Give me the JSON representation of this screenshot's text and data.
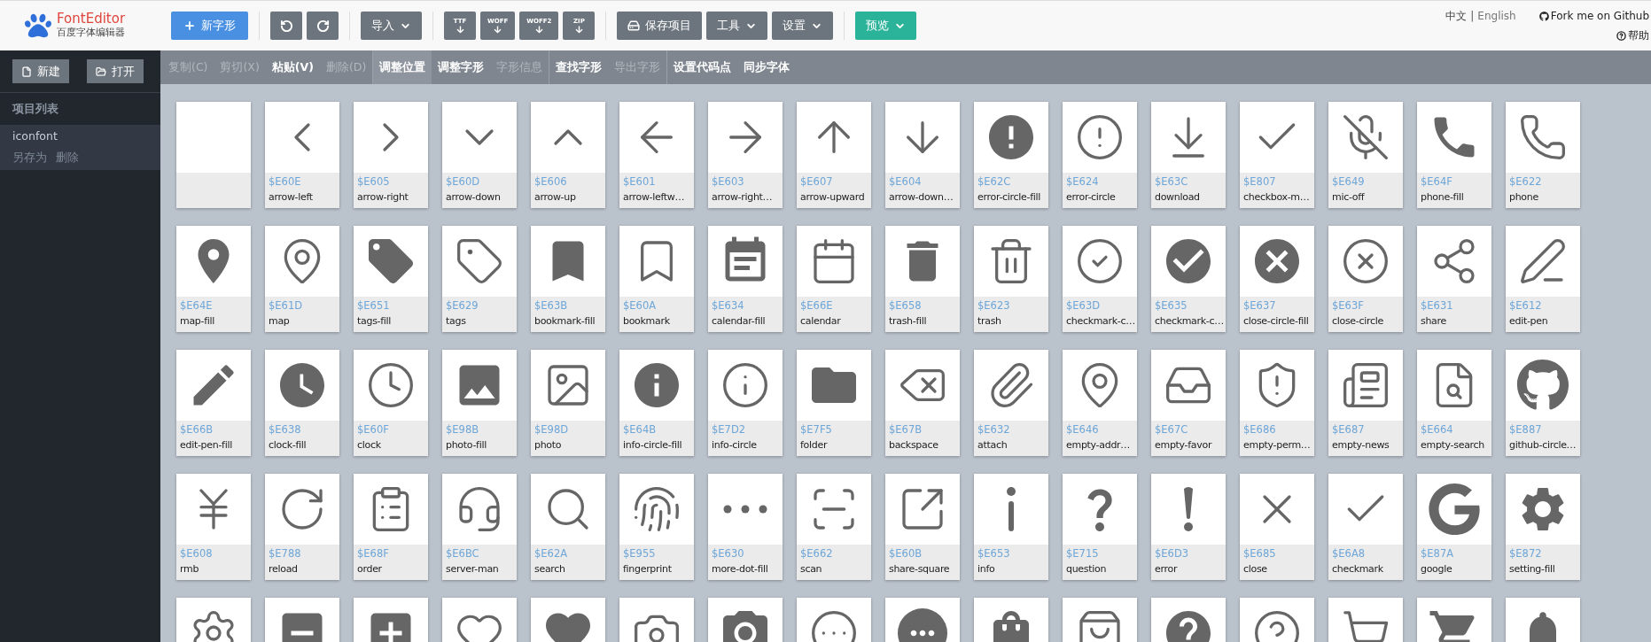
{
  "header": {
    "logo_title": "FontEditor",
    "logo_subtitle": "百度字体编辑器",
    "buttons": [
      {
        "kind": "primary",
        "label": "新字形"
      },
      {
        "kind": "undo"
      },
      {
        "kind": "redo"
      },
      {
        "kind": "dropdown",
        "label": "导入"
      },
      {
        "kind": "format",
        "label": "TTF"
      },
      {
        "kind": "format",
        "label": "WOFF"
      },
      {
        "kind": "format",
        "label": "WOFF2"
      },
      {
        "kind": "format",
        "label": "ZIP"
      },
      {
        "kind": "save",
        "label": "保存项目"
      },
      {
        "kind": "dropdown",
        "label": "工具"
      },
      {
        "kind": "dropdown",
        "label": "设置"
      },
      {
        "kind": "preview",
        "label": "预览"
      }
    ],
    "languages": [
      {
        "label": "中文",
        "selected": true
      },
      {
        "label": "English",
        "selected": false
      }
    ],
    "language_separator": "|",
    "github_link": "Fork me on Github",
    "help_link": "帮助"
  },
  "sidebar": {
    "buttons": [
      {
        "label": "新建"
      },
      {
        "label": "打开"
      }
    ],
    "heading": "项目列表",
    "projects": [
      {
        "name": "iconfont",
        "selected": true,
        "actions": [
          "另存为",
          "删除"
        ]
      }
    ]
  },
  "toolbar": {
    "groups": [
      [
        {
          "label": "复制(C)",
          "disabled": true,
          "selected": false
        },
        {
          "label": "剪切(X)",
          "disabled": true,
          "selected": false
        },
        {
          "label": "粘贴(V)",
          "disabled": false,
          "selected": false
        },
        {
          "label": "删除(D)",
          "disabled": true,
          "selected": false
        }
      ],
      [
        {
          "label": "调整位置",
          "disabled": false,
          "selected": true
        },
        {
          "label": "调整字形",
          "disabled": false,
          "selected": false
        },
        {
          "label": "字形信息",
          "disabled": true,
          "selected": false
        }
      ],
      [
        {
          "label": "查找字形",
          "disabled": false,
          "selected": false
        },
        {
          "label": "导出字形",
          "disabled": true,
          "selected": false
        }
      ],
      [
        {
          "label": "设置代码点",
          "disabled": false,
          "selected": false
        },
        {
          "label": "同步字体",
          "disabled": false,
          "selected": false
        }
      ]
    ]
  },
  "glyphs": [
    {
      "kind": "blank"
    },
    {
      "kind": "glyph",
      "code": "$E60E",
      "name": "arrow-left"
    },
    {
      "kind": "glyph",
      "code": "$E605",
      "name": "arrow-right"
    },
    {
      "kind": "glyph",
      "code": "$E60D",
      "name": "arrow-down"
    },
    {
      "kind": "glyph",
      "code": "$E606",
      "name": "arrow-up"
    },
    {
      "kind": "glyph",
      "code": "$E601",
      "name": "arrow-leftw…"
    },
    {
      "kind": "glyph",
      "code": "$E603",
      "name": "arrow-right…"
    },
    {
      "kind": "glyph",
      "code": "$E607",
      "name": "arrow-upward"
    },
    {
      "kind": "glyph",
      "code": "$E604",
      "name": "arrow-down…"
    },
    {
      "kind": "glyph",
      "code": "$E62C",
      "name": "error-circle-fill"
    },
    {
      "kind": "glyph",
      "code": "$E624",
      "name": "error-circle"
    },
    {
      "kind": "glyph",
      "code": "$E63C",
      "name": "download"
    },
    {
      "kind": "glyph",
      "code": "$E807",
      "name": "checkbox-m…"
    },
    {
      "kind": "glyph",
      "code": "$E649",
      "name": "mic-off"
    },
    {
      "kind": "glyph",
      "code": "$E64F",
      "name": "phone-fill"
    },
    {
      "kind": "glyph",
      "code": "$E622",
      "name": "phone"
    },
    {
      "kind": "glyph",
      "code": "$E64E",
      "name": "map-fill"
    },
    {
      "kind": "glyph",
      "code": "$E61D",
      "name": "map"
    },
    {
      "kind": "glyph",
      "code": "$E651",
      "name": "tags-fill"
    },
    {
      "kind": "glyph",
      "code": "$E629",
      "name": "tags"
    },
    {
      "kind": "glyph",
      "code": "$E63B",
      "name": "bookmark-fill"
    },
    {
      "kind": "glyph",
      "code": "$E60A",
      "name": "bookmark"
    },
    {
      "kind": "glyph",
      "code": "$E634",
      "name": "calendar-fill"
    },
    {
      "kind": "glyph",
      "code": "$E66E",
      "name": "calendar"
    },
    {
      "kind": "glyph",
      "code": "$E658",
      "name": "trash-fill"
    },
    {
      "kind": "glyph",
      "code": "$E623",
      "name": "trash"
    },
    {
      "kind": "glyph",
      "code": "$E63D",
      "name": "checkmark-c…"
    },
    {
      "kind": "glyph",
      "code": "$E635",
      "name": "checkmark-c…"
    },
    {
      "kind": "glyph",
      "code": "$E637",
      "name": "close-circle-fill"
    },
    {
      "kind": "glyph",
      "code": "$E63F",
      "name": "close-circle"
    },
    {
      "kind": "glyph",
      "code": "$E631",
      "name": "share"
    },
    {
      "kind": "glyph",
      "code": "$E612",
      "name": "edit-pen"
    },
    {
      "kind": "glyph",
      "code": "$E66B",
      "name": "edit-pen-fill"
    },
    {
      "kind": "glyph",
      "code": "$E638",
      "name": "clock-fill"
    },
    {
      "kind": "glyph",
      "code": "$E60F",
      "name": "clock"
    },
    {
      "kind": "glyph",
      "code": "$E98B",
      "name": "photo-fill"
    },
    {
      "kind": "glyph",
      "code": "$E98D",
      "name": "photo"
    },
    {
      "kind": "glyph",
      "code": "$E64B",
      "name": "info-circle-fill"
    },
    {
      "kind": "glyph",
      "code": "$E7D2",
      "name": "info-circle"
    },
    {
      "kind": "glyph",
      "code": "$E7F5",
      "name": "folder"
    },
    {
      "kind": "glyph",
      "code": "$E67B",
      "name": "backspace"
    },
    {
      "kind": "glyph",
      "code": "$E632",
      "name": "attach"
    },
    {
      "kind": "glyph",
      "code": "$E646",
      "name": "empty-addr…"
    },
    {
      "kind": "glyph",
      "code": "$E67C",
      "name": "empty-favor"
    },
    {
      "kind": "glyph",
      "code": "$E686",
      "name": "empty-perm…"
    },
    {
      "kind": "glyph",
      "code": "$E687",
      "name": "empty-news"
    },
    {
      "kind": "glyph",
      "code": "$E664",
      "name": "empty-search"
    },
    {
      "kind": "glyph",
      "code": "$E887",
      "name": "github-circle…"
    },
    {
      "kind": "glyph",
      "code": "$E608",
      "name": "rmb"
    },
    {
      "kind": "glyph",
      "code": "$E788",
      "name": "reload"
    },
    {
      "kind": "glyph",
      "code": "$E68F",
      "name": "order"
    },
    {
      "kind": "glyph",
      "code": "$E6BC",
      "name": "server-man"
    },
    {
      "kind": "glyph",
      "code": "$E62A",
      "name": "search"
    },
    {
      "kind": "glyph",
      "code": "$E955",
      "name": "fingerprint"
    },
    {
      "kind": "glyph",
      "code": "$E630",
      "name": "more-dot-fill"
    },
    {
      "kind": "glyph",
      "code": "$E662",
      "name": "scan"
    },
    {
      "kind": "glyph",
      "code": "$E60B",
      "name": "share-square"
    },
    {
      "kind": "glyph",
      "code": "$E653",
      "name": "info"
    },
    {
      "kind": "glyph",
      "code": "$E715",
      "name": "question"
    },
    {
      "kind": "glyph",
      "code": "$E6D3",
      "name": "error"
    },
    {
      "kind": "glyph",
      "code": "$E685",
      "name": "close"
    },
    {
      "kind": "glyph",
      "code": "$E6A8",
      "name": "checkmark"
    },
    {
      "kind": "glyph",
      "code": "$E87A",
      "name": "google"
    },
    {
      "kind": "glyph",
      "code": "$E872",
      "name": "setting-fill"
    },
    {
      "kind": "glyph"
    },
    {
      "kind": "glyph"
    },
    {
      "kind": "glyph"
    },
    {
      "kind": "glyph"
    },
    {
      "kind": "glyph"
    },
    {
      "kind": "glyph"
    },
    {
      "kind": "glyph"
    },
    {
      "kind": "glyph"
    },
    {
      "kind": "glyph"
    },
    {
      "kind": "glyph"
    },
    {
      "kind": "glyph"
    },
    {
      "kind": "glyph"
    },
    {
      "kind": "glyph"
    },
    {
      "kind": "glyph"
    },
    {
      "kind": "glyph"
    },
    {
      "kind": "glyph"
    }
  ]
}
